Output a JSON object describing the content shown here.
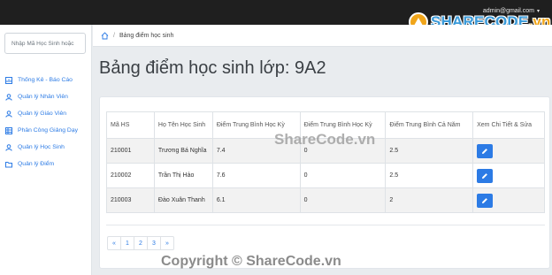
{
  "header": {
    "user_email": "admin@gmail.com",
    "logo_main": "SHARECODE",
    "logo_tld": ".vn"
  },
  "sidebar": {
    "search_placeholder": "Nhập Mã Học Sinh hoặc",
    "items": [
      {
        "label": "Thống Kê - Báo Cáo",
        "icon": "chart-icon"
      },
      {
        "label": "Quản lý Nhân Viên",
        "icon": "user-icon"
      },
      {
        "label": "Quản lý Giáo Viên",
        "icon": "user-icon"
      },
      {
        "label": "Phân Công Giảng Dạy",
        "icon": "table-icon"
      },
      {
        "label": "Quản lý Học Sinh",
        "icon": "user-icon"
      },
      {
        "label": "Quản lý Điểm",
        "icon": "folder-icon"
      }
    ]
  },
  "breadcrumb": {
    "separator": "/",
    "current": "Bảng điểm học sinh"
  },
  "page": {
    "title": "Bảng điểm học sinh lớp: 9A2"
  },
  "table": {
    "headers": [
      "Mã HS",
      "Họ Tên Học Sinh",
      "Điểm Trung Bình Học Kỳ",
      "Điểm Trung Bình Học Kỳ",
      "Điểm Trung Bình Cả Năm",
      "Xem Chi Tiết & Sửa"
    ],
    "rows": [
      [
        "210001",
        "Trương Bá Nghĩa",
        "7.4",
        "0",
        "2.5"
      ],
      [
        "210002",
        "Trần Thị Hảo",
        "7.6",
        "0",
        "2.5"
      ],
      [
        "210003",
        "Đào Xuân Thanh",
        "6.1",
        "0",
        "2"
      ]
    ]
  },
  "pagination": {
    "prev": "«",
    "pages": [
      "1",
      "2",
      "3"
    ],
    "next": "»"
  },
  "watermarks": {
    "center": "ShareCode.vn",
    "bottom": "Copyright © ShareCode.vn"
  },
  "colors": {
    "accent": "#2c7be5",
    "topbar": "#1f1f1f",
    "logo_blue": "#3a9ad9",
    "logo_orange": "#f0a51a"
  }
}
